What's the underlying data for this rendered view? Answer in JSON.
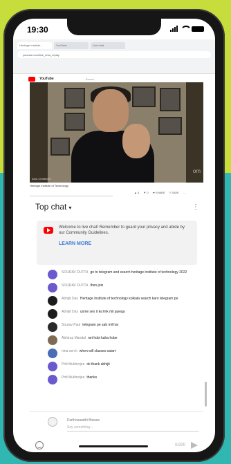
{
  "status": {
    "time": "19:30",
    "location_arrow": "↗"
  },
  "browser": {
    "tabs": [
      "Heritage Institute...",
      "YouTube",
      "Live chat"
    ],
    "url": "youtube.com/live_chat_replay"
  },
  "youtube": {
    "logo_text": "YouTube",
    "search_placeholder": "Search"
  },
  "video": {
    "caption": "Arka Chatterjee",
    "watermark": "om",
    "title": "Heritage Institute of Technology",
    "actions": [
      "▲ 4",
      "▼ 0",
      "➦ SHARE",
      "≡ SAVE",
      "…"
    ]
  },
  "chat": {
    "title": "Top chat",
    "caret": "▾",
    "menu": "⋮",
    "welcome_text": "Welcome to live chat! Remember to guard your privacy and abide by our Community Guidelines.",
    "learn_more": "LEARN MORE",
    "messages": [
      {
        "author": "SOURAV DUTTA",
        "text": "go to telegram and search heritage institute of technology 2022",
        "avatar_color": "#6a5acd"
      },
      {
        "author": "SOURAV DUTTA",
        "text": "then join",
        "avatar_color": "#6a5acd"
      },
      {
        "author": "Abhijit Das",
        "text": "Heritage Institute of technology kolkata search karo telegram pe",
        "avatar_color": "#1c1c1c"
      },
      {
        "author": "Abhijit Das",
        "text": "usme sex it ka link mil jayega",
        "avatar_color": "#1c1c1c"
      },
      {
        "author": "Sourav Paul",
        "text": "telegram pe sab mil hai",
        "avatar_color": "#2a2a2a"
      },
      {
        "author": "Abhirup Mandal",
        "text": "net hobi kaha hobe",
        "avatar_color": "#7d6b55"
      },
      {
        "author": "nina sen k",
        "text": "when will classes satart",
        "avatar_color": "#4b6cb7"
      },
      {
        "author": "Priti Mukherjee",
        "text": "ok thank abhijit",
        "avatar_color": "#6a5acd"
      },
      {
        "author": "Priti Mukherjee",
        "text": "thanks",
        "avatar_color": "#6a5acd"
      }
    ],
    "compose_user": "Parthosarathi Biswas",
    "compose_placeholder": "Say something...",
    "counter": "0/200"
  }
}
